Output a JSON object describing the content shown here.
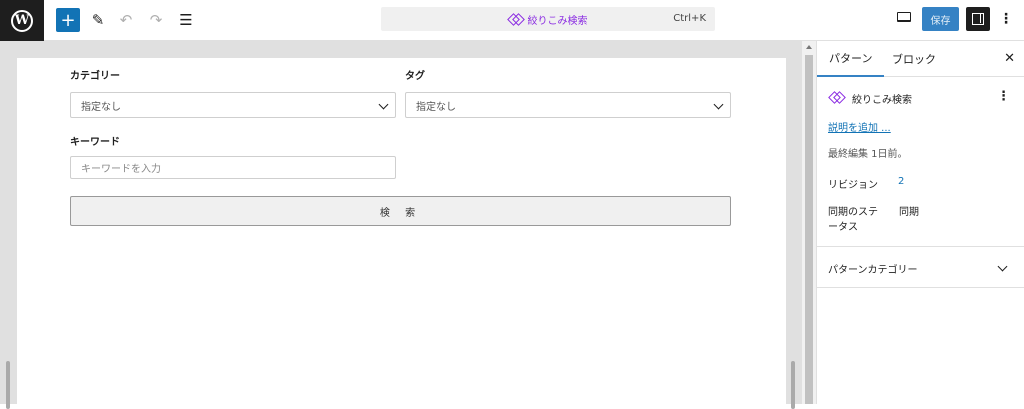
{
  "toolbar": {
    "add_icon": "+",
    "tool_icon": "✎",
    "undo_icon": "↶",
    "redo_icon": "↷",
    "list_view_icon": "☰",
    "command_title": "絞りこみ検索",
    "command_shortcut": "Ctrl+K",
    "save_label": "保存",
    "more_icon": "⋮",
    "colors": {
      "accent": "#3582c4",
      "pattern_purple": "#8a2be2"
    }
  },
  "form": {
    "category_label": "カテゴリー",
    "category_value": "指定なし",
    "tag_label": "タグ",
    "tag_value": "指定なし",
    "keyword_label": "キーワード",
    "keyword_placeholder": "キーワードを入力",
    "search_button": "検 索"
  },
  "sidebar": {
    "tab_pattern": "パターン",
    "tab_block": "ブロック",
    "close_icon": "✕",
    "pattern_name": "絞りこみ検索",
    "more_icon": "⋮",
    "add_description": "説明を追加 ...",
    "last_edited": "最終編集 1日前。",
    "revisions_label": "リビジョン",
    "revisions_value": "2",
    "sync_status_label_line1": "同期のステ",
    "sync_status_label_line2": "ータス",
    "sync_status_value": "同期",
    "pattern_category_label": "パターンカテゴリー"
  }
}
